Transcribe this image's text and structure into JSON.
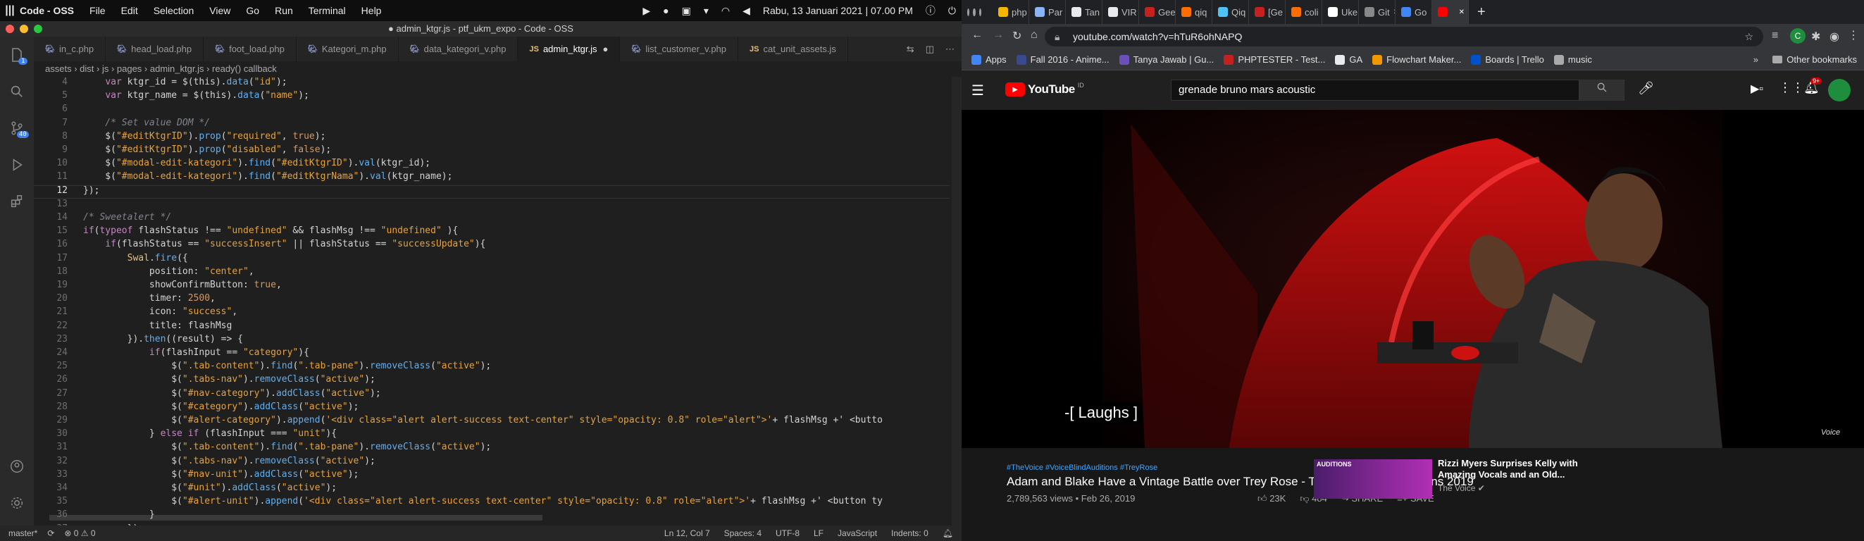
{
  "system": {
    "app_name": "Code - OSS",
    "menus": [
      "File",
      "Edit",
      "Selection",
      "View",
      "Go",
      "Run",
      "Terminal",
      "Help"
    ],
    "datetime": "Rabu, 13 Januari 2021 | 07.00 PM"
  },
  "vscode": {
    "window_title": "● admin_ktgr.js - ptf_ukm_expo - Code - OSS",
    "tabs": [
      {
        "label": "in_c.php",
        "icon": "php-icon"
      },
      {
        "label": "head_load.php",
        "icon": "php-icon"
      },
      {
        "label": "foot_load.php",
        "icon": "php-icon"
      },
      {
        "label": "Kategori_m.php",
        "icon": "php-icon"
      },
      {
        "label": "data_kategori_v.php",
        "icon": "php-icon"
      },
      {
        "label": "admin_ktgr.js",
        "icon": "js-icon",
        "active": true,
        "modified": true
      },
      {
        "label": "list_customer_v.php",
        "icon": "php-icon"
      },
      {
        "label": "cat_unit_assets.js",
        "icon": "js-icon"
      }
    ],
    "breadcrumb": [
      "assets",
      "dist",
      "js",
      "pages",
      "admin_ktgr.js",
      "ready() callback"
    ],
    "activity_badges": {
      "explorer": "1",
      "scm": "40"
    },
    "line_numbers": [
      "4",
      "5",
      "6",
      "7",
      "8",
      "9",
      "10",
      "11",
      "12",
      "13",
      "14",
      "15",
      "16",
      "17",
      "18",
      "19",
      "20",
      "21",
      "22",
      "23",
      "24",
      "25",
      "26",
      "27",
      "28",
      "29",
      "30",
      "31",
      "32",
      "33",
      "34",
      "35",
      "36",
      "37"
    ],
    "code_lines": [
      "    var ktgr_id = $(this).data(\"id\");",
      "    var ktgr_name = $(this).data(\"name\");",
      "",
      "    /* Set value DOM */",
      "    $(\"#editKtgrID\").prop(\"required\", true);",
      "    $(\"#editKtgrID\").prop(\"disabled\", false);",
      "    $(\"#modal-edit-kategori\").find(\"#editKtgrID\").val(ktgr_id);",
      "    $(\"#modal-edit-kategori\").find(\"#editKtgrNama\").val(ktgr_name);",
      "});",
      "",
      "/* Sweetalert */",
      "if(typeof flashStatus !== \"undefined\" && flashMsg !== \"undefined\" ){",
      "    if(flashStatus == \"successInsert\" || flashStatus == \"successUpdate\"){",
      "        Swal.fire({",
      "            position: \"center\",",
      "            showConfirmButton: true,",
      "            timer: 2500,",
      "            icon: \"success\",",
      "            title: flashMsg",
      "        }).then((result) => {",
      "            if(flashInput == \"category\"){",
      "                $(\".tab-content\").find(\".tab-pane\").removeClass(\"active\");",
      "                $(\".tabs-nav\").removeClass(\"active\");",
      "                $(\"#nav-category\").addClass(\"active\");",
      "                $(\"#category\").addClass(\"active\");",
      "                $(\"#alert-category\").append('<div class=\"alert alert-success text-center\" style=\"opacity: 0.8\" role=\"alert\">'+ flashMsg +' <butto",
      "            } else if (flashInput === \"unit\"){",
      "                $(\".tab-content\").find(\".tab-pane\").removeClass(\"active\");",
      "                $(\".tabs-nav\").removeClass(\"active\");",
      "                $(\"#nav-unit\").addClass(\"active\");",
      "                $(\"#unit\").addClass(\"active\");",
      "                $(\"#alert-unit\").append('<div class=\"alert alert-success text-center\" style=\"opacity: 0.8\" role=\"alert\">'+ flashMsg +' <button ty",
      "            }",
      "        })"
    ],
    "status": {
      "branch": "master*",
      "problems": "⊗ 0 ⚠ 0",
      "position": "Ln 12, Col 7",
      "spaces": "Spaces: 4",
      "encoding": "UTF-8",
      "eol": "LF",
      "language": "JavaScript",
      "indents": "Indents: 0"
    }
  },
  "chrome": {
    "tabs": [
      {
        "label": "php",
        "color": "#f4b400"
      },
      {
        "label": "Par",
        "color": "#8ab4f8"
      },
      {
        "label": "Tan",
        "color": "#e8eaed"
      },
      {
        "label": "VIR",
        "color": "#e8eaed"
      },
      {
        "label": "Gee",
        "color": "#c5221f"
      },
      {
        "label": "qiq",
        "color": "#ff6d00"
      },
      {
        "label": "Qiq",
        "color": "#4fc3f7"
      },
      {
        "label": "[Ge",
        "color": "#c5221f"
      },
      {
        "label": "coli",
        "color": "#ff6d00"
      },
      {
        "label": "Uke",
        "color": "#ffffff"
      },
      {
        "label": "Git",
        "color": "#888888"
      },
      {
        "label": "Go",
        "color": "#4285f4"
      },
      {
        "label": "",
        "color": "#ff0000",
        "active": true
      }
    ],
    "url": "youtube.com/watch?v=hTuR6ohNAPQ",
    "profile_initial": "C",
    "bookmarks": [
      {
        "label": "Apps"
      },
      {
        "label": "Fall 2016 - Anime..."
      },
      {
        "label": "Tanya Jawab | Gu..."
      },
      {
        "label": "PHPTESTER - Test..."
      },
      {
        "label": "GA"
      },
      {
        "label": "Flowchart Maker..."
      },
      {
        "label": "Boards | Trello"
      },
      {
        "label": "music"
      }
    ],
    "other_bookmarks": "Other bookmarks"
  },
  "youtube": {
    "logo_text": "YouTube",
    "logo_region": "ID",
    "search_query": "grenade bruno mars acoustic",
    "notification_count": "9+",
    "caption": "-[ Laughs ]",
    "watermark": "Voice",
    "hashtags": "#TheVoice #VoiceBlindAuditions #TreyRose",
    "video_title": "Adam and Blake Have a Vintage Battle over Trey Rose - The Voice Blind Auditions 2019",
    "video_meta": "2,789,563 views • Feb 26, 2019",
    "likes": "23K",
    "dislikes": "484",
    "share_label": "SHARE",
    "save_label": "SAVE",
    "suggested": {
      "badge": "AUDITIONS",
      "title": "Rizzi Myers Surprises Kelly with Amazing Vocals and an Old...",
      "channel": "The Voice"
    }
  }
}
